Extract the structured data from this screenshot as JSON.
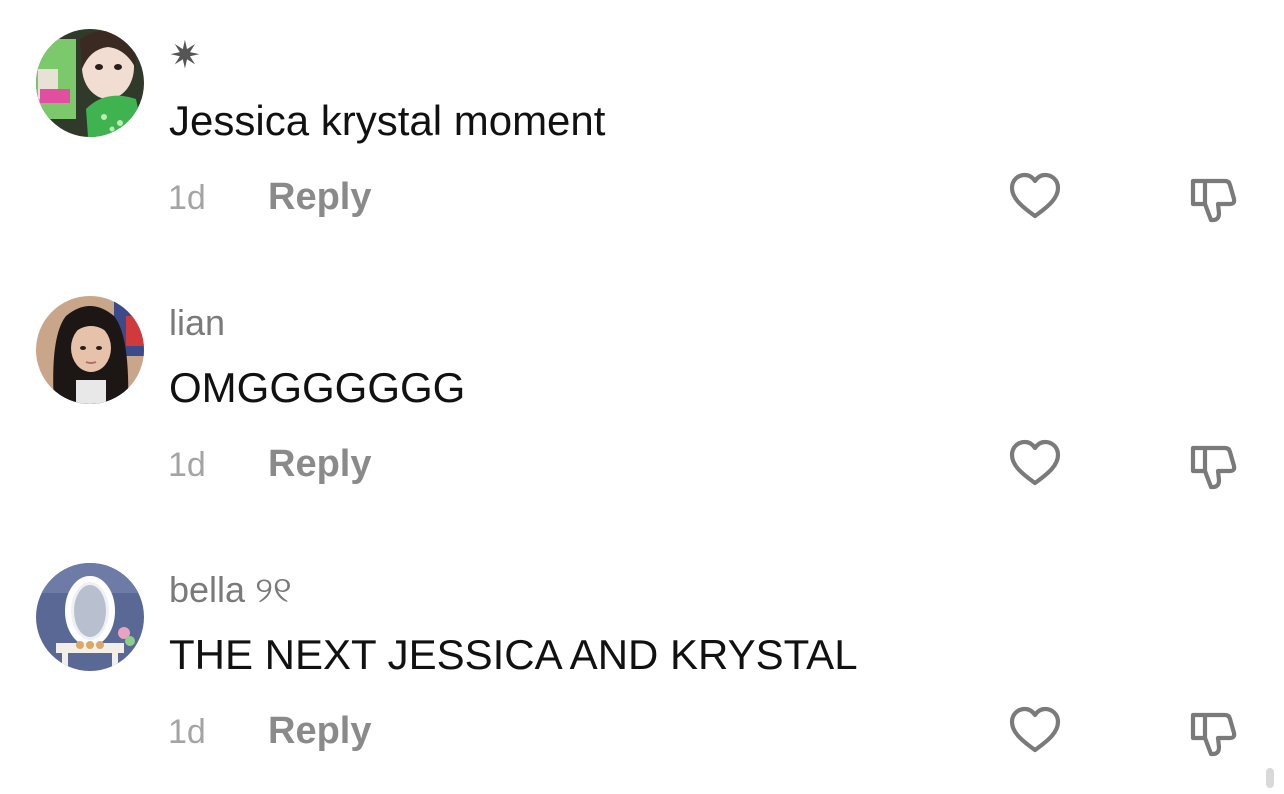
{
  "colors": {
    "username": "#7a7a7a",
    "comment_text": "#111111",
    "timestamp": "#a4a4a4",
    "reply": "#8a8a8a",
    "icon_stroke": "#7a7a7a"
  },
  "comments": [
    {
      "username": "✷",
      "text": "Jessica krystal moment",
      "timestamp": "1d",
      "reply_label": "Reply",
      "avatar_icon": "avatar-green-photo",
      "like_icon": "heart-outline-icon",
      "dislike_icon": "thumbs-down-outline-icon"
    },
    {
      "username": "lian",
      "text": "OMGGGGGGG",
      "timestamp": "1d",
      "reply_label": "Reply",
      "avatar_icon": "avatar-dark-hair-photo",
      "like_icon": "heart-outline-icon",
      "dislike_icon": "thumbs-down-outline-icon"
    },
    {
      "username": "bella ୨୧",
      "text": "THE NEXT JESSICA AND KRYSTAL",
      "timestamp": "1d",
      "reply_label": "Reply",
      "avatar_icon": "avatar-mirror-vanity-photo",
      "like_icon": "heart-outline-icon",
      "dislike_icon": "thumbs-down-outline-icon"
    }
  ]
}
